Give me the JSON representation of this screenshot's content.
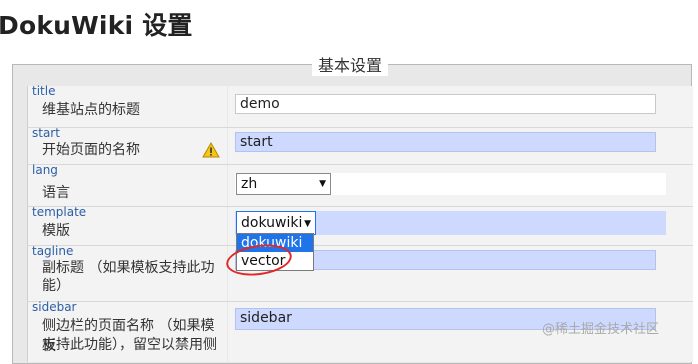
{
  "page": {
    "title": "DokuWiki 设置"
  },
  "section": {
    "legend": "基本设置"
  },
  "settings": [
    {
      "key": "title",
      "description": "维基站点的标题",
      "value": "demo"
    },
    {
      "key": "start",
      "description": "开始页面的名称",
      "value": "start",
      "warning": "warning-icon"
    },
    {
      "key": "lang",
      "description": "语言",
      "value": "zh"
    },
    {
      "key": "template",
      "description": "模版",
      "value": "dokuwiki",
      "options": [
        "dokuwiki",
        "vector"
      ]
    },
    {
      "key": "tagline",
      "description_line1": "副标题 （如果模板支持此功",
      "description_line2": "能）",
      "value": ""
    },
    {
      "key": "sidebar",
      "description_line1": "侧边栏的页面名称 （如果模板",
      "description_line2": "支持此功能），留空以禁用侧",
      "value": "sidebar"
    }
  ],
  "colors": {
    "modified_field": "#cdd9ff",
    "selected_option": "#1e74e8",
    "annotation": "#e0282a"
  },
  "watermark": "@稀土掘金技术社区"
}
